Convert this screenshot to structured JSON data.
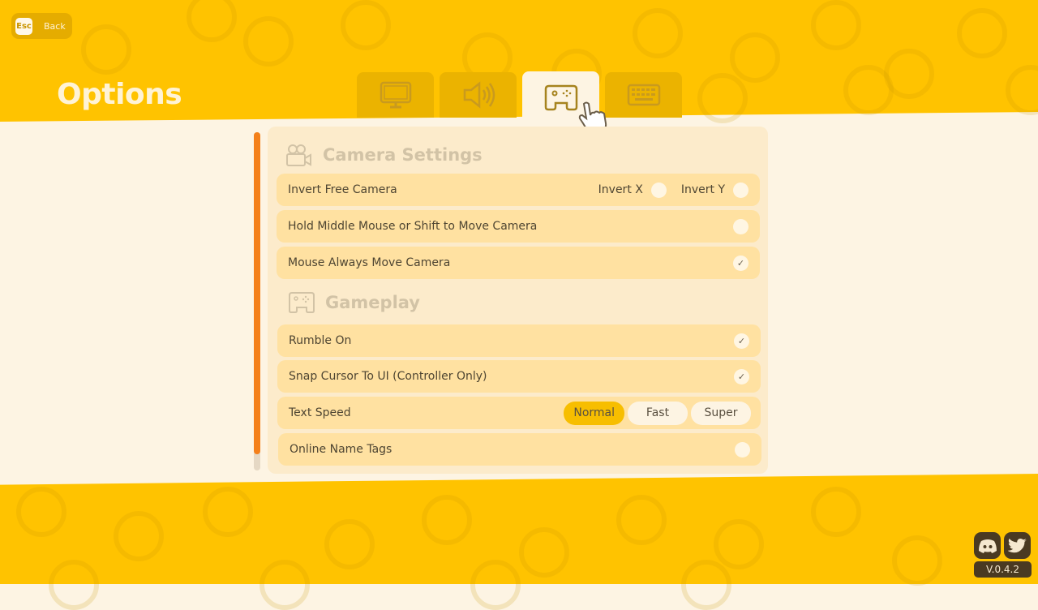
{
  "header": {
    "back": {
      "key_label": "Esc",
      "label": "Back"
    },
    "title": "Options"
  },
  "tabs": [
    {
      "name": "display",
      "icon": "monitor-icon",
      "active": false
    },
    {
      "name": "audio",
      "icon": "speaker-icon",
      "active": false
    },
    {
      "name": "controls",
      "icon": "gamepad-icon",
      "active": true
    },
    {
      "name": "keyboard",
      "icon": "keyboard-icon",
      "active": false
    }
  ],
  "sections": {
    "camera": {
      "title": "Camera Settings",
      "icon": "video-camera-icon",
      "rows": [
        {
          "label": "Invert Free Camera",
          "options": [
            {
              "label": "Invert X",
              "checked": false
            },
            {
              "label": "Invert Y",
              "checked": false
            }
          ]
        },
        {
          "label": "Hold Middle Mouse or Shift to Move Camera",
          "checked": false
        },
        {
          "label": "Mouse Always Move Camera",
          "checked": true
        }
      ]
    },
    "gameplay": {
      "title": "Gameplay",
      "icon": "gamepad-icon",
      "rows": [
        {
          "label": "Rumble On",
          "checked": true
        },
        {
          "label": "Snap Cursor To UI (Controller Only)",
          "checked": true
        },
        {
          "label": "Text Speed",
          "choices": [
            "Normal",
            "Fast",
            "Super"
          ],
          "selected": "Normal"
        },
        {
          "label": "Online Name Tags",
          "checked": false
        }
      ]
    }
  },
  "scroll": {
    "position_fraction": 0.95
  },
  "footer": {
    "social": [
      "discord-icon",
      "twitter-icon"
    ],
    "version": "V.0.4.2"
  },
  "colors": {
    "brand_yellow": "#FFC300",
    "panel": "#FCEBCB",
    "row": "#FFE1A1",
    "scroll_accent": "#F4801A",
    "selected_choice": "#F7BE00"
  },
  "checkmark": "✓"
}
